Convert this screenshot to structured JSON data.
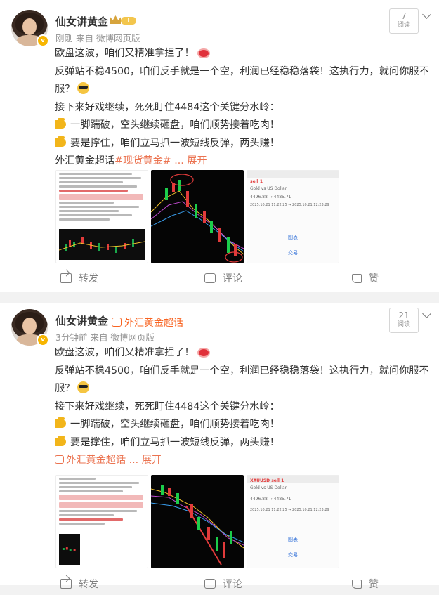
{
  "posts": [
    {
      "author": "仙女讲黄金",
      "member_badge": "I",
      "time": "刚刚",
      "source": "来自 微博网页版",
      "reads_count": "7",
      "reads_label": "阅读",
      "lines": {
        "l1": "欧盘这波，咱们又精准拿捏了！",
        "l2": "反弹站不稳4500，咱们反手就是一个空，利润已经稳稳落袋！这执行力，就问你服不服？",
        "l3": "接下来好戏继续，死死盯住4484这个关键分水岭：",
        "l4": "一脚踹破，空头继续砸盘，咱们顺势接着吃肉！",
        "l5": "要是撑住，咱们立马抓一波短线反弹，两头赚！",
        "l6_prefix": "外汇黄金超话",
        "l6_tag": "#现货黄金#",
        "l6_more": "... 展开"
      },
      "actions": {
        "repost": "转发",
        "comment": "评论",
        "like": "赞"
      }
    },
    {
      "author": "仙女讲黄金",
      "super_topic": "外汇黄金超话",
      "time": "3分钟前",
      "source": "来自 微博网页版",
      "reads_count": "21",
      "reads_label": "阅读",
      "lines": {
        "l1": "欧盘这波，咱们又精准拿捏了！",
        "l2": "反弹站不稳4500，咱们反手就是一个空，利润已经稳稳落袋！这执行力，就问你服不服？",
        "l3": "接下来好戏继续，死死盯住4484这个关键分水岭：",
        "l4": "一脚踹破，空头继续砸盘，咱们顺势接着吃肉！",
        "l5": "要是撑住，咱们立马抓一波短线反弹，两头赚！",
        "l6_tag": "外汇黄金超话",
        "l6_more": "... 展开"
      },
      "actions": {
        "repost": "转发",
        "comment": "评论",
        "like": "赞"
      }
    }
  ],
  "thumb_app_1": {
    "symbol": "sell 1",
    "subtitle": "Gold vs US Dollar",
    "price_line": "4496.88 → 4485.71",
    "time_line": "2025.10.21 11:22:25 → 2025.10.21 12:23:29",
    "btn1": "图表",
    "btn2": "交易"
  },
  "thumb_app_2": {
    "symbol": "XAUUSD sell 1",
    "subtitle": "Gold vs US Dollar",
    "price_line": "4496.88 → 4485.71",
    "time_line": "2025.10.21 11:22:25 → 2025.10.21 12:23:29",
    "btn1": "图表",
    "btn2": "交易"
  },
  "colors": {
    "link": "#eb7350",
    "gold": "#f7b500",
    "muted": "#939393"
  }
}
